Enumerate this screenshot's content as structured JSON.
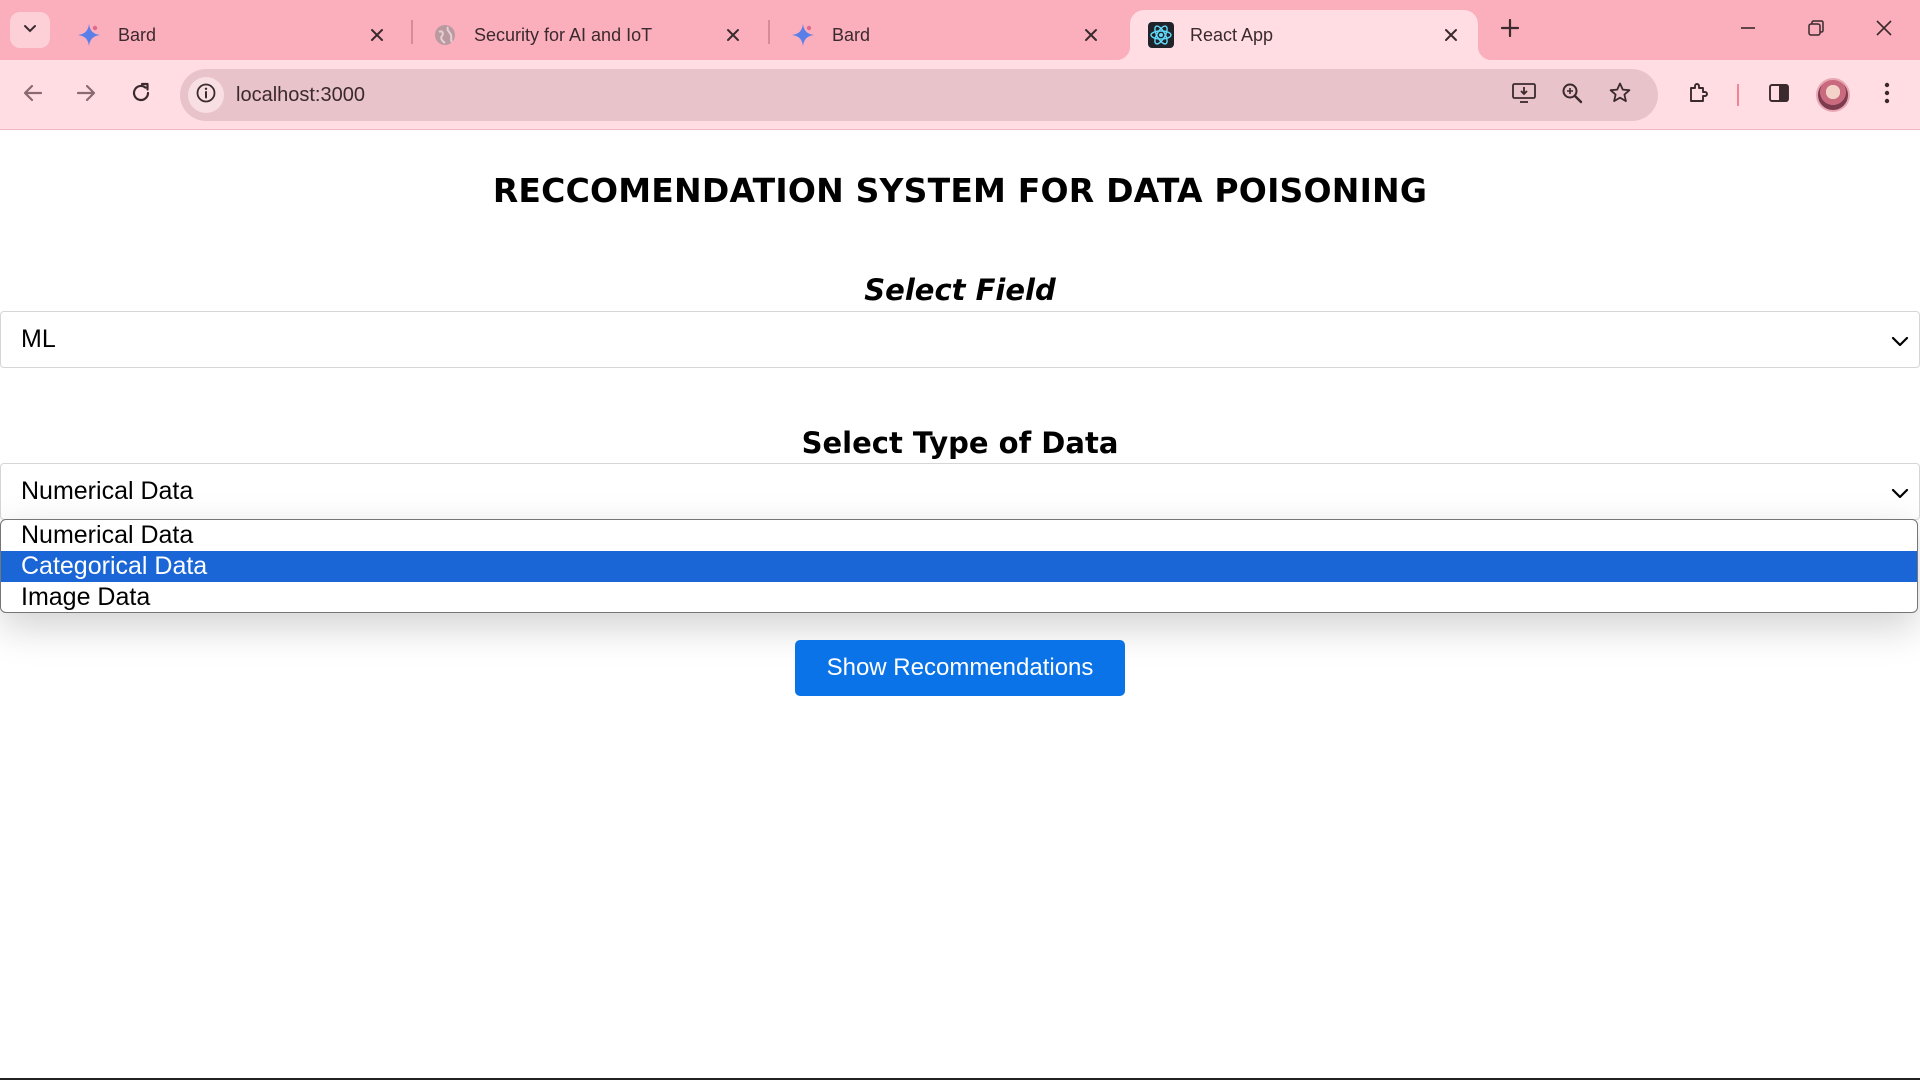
{
  "browser": {
    "tabs": [
      {
        "title": "Bard",
        "icon": "bard-sparkle-icon"
      },
      {
        "title": "Security for AI and IoT",
        "icon": "globe-icon"
      },
      {
        "title": "Bard",
        "icon": "bard-sparkle-icon"
      },
      {
        "title": "React App",
        "icon": "react-icon",
        "active": true
      }
    ],
    "url": "localhost:3000",
    "colors": {
      "frame": "#fbaebc",
      "toolbar": "#ffdde3"
    }
  },
  "page": {
    "title": "RECCOMENDATION SYSTEM FOR DATA POISONING",
    "field_label": "Select Field",
    "field_value": "ML",
    "type_label": "Select Type of Data",
    "type_value": "Numerical Data",
    "type_options": [
      "Numerical Data",
      "Categorical Data",
      "Image Data"
    ],
    "highlighted_option": "Categorical Data",
    "button_label": "Show Recommendations",
    "colors": {
      "button": "#0a73e8",
      "highlight": "#1a66d6"
    }
  }
}
